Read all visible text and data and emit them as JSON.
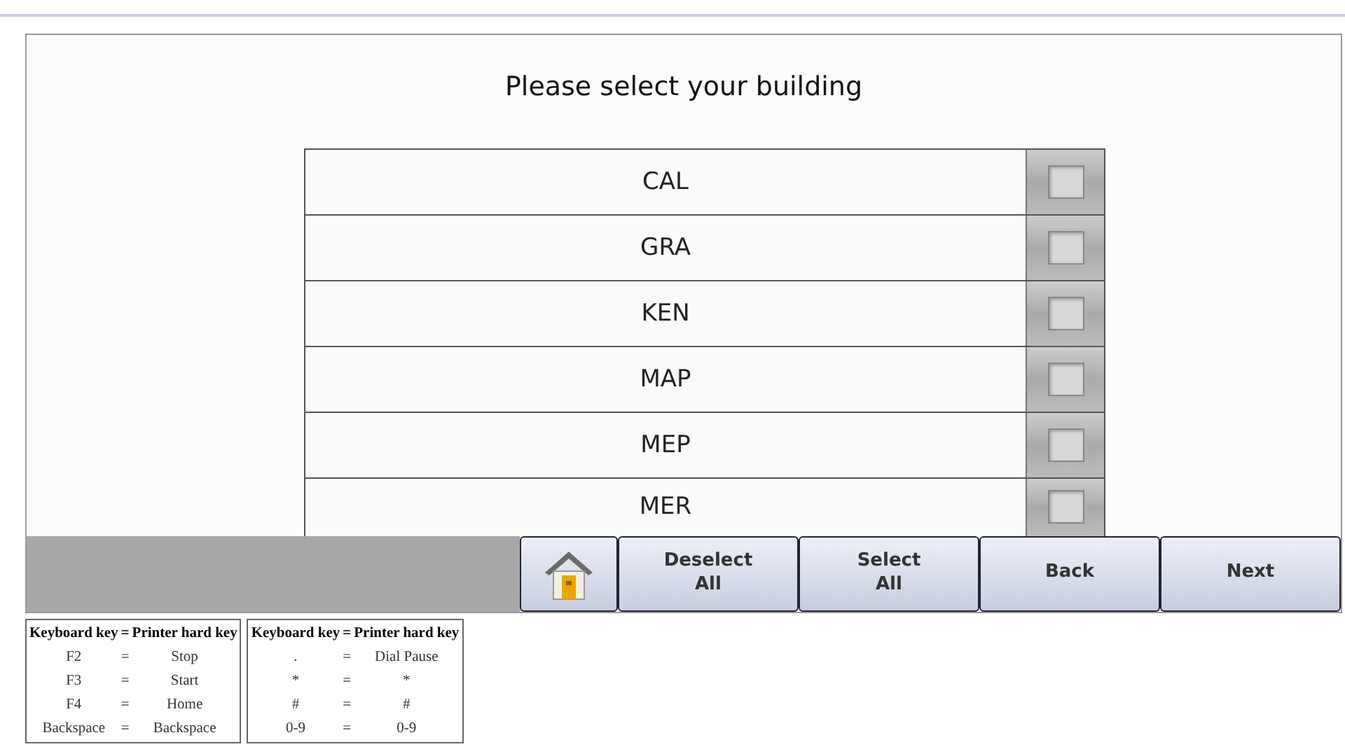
{
  "title": "Please select your building",
  "buildings": [
    {
      "name": "CAL",
      "checked": false
    },
    {
      "name": "GRA",
      "checked": false
    },
    {
      "name": "KEN",
      "checked": false
    },
    {
      "name": "MAP",
      "checked": false
    },
    {
      "name": "MEP",
      "checked": false
    },
    {
      "name": "MER",
      "checked": false
    }
  ],
  "toolbar": [
    {
      "kind": "home"
    },
    {
      "kind": "text",
      "label": "Deselect\nAll"
    },
    {
      "kind": "text",
      "label": "Select\nAll"
    },
    {
      "kind": "text",
      "label": "Back"
    },
    {
      "kind": "text",
      "label": "Next"
    }
  ],
  "key_tables": [
    {
      "header": [
        "Keyboard key",
        "=",
        "Printer hard key"
      ],
      "rows": [
        [
          "F2",
          "=",
          "Stop"
        ],
        [
          "F3",
          "=",
          "Start"
        ],
        [
          "F4",
          "=",
          "Home"
        ],
        [
          "Backspace",
          "=",
          "Backspace"
        ]
      ]
    },
    {
      "header": [
        "Keyboard key",
        "=",
        "Printer hard key"
      ],
      "rows": [
        [
          ".",
          "=",
          "Dial Pause"
        ],
        [
          "*",
          "=",
          "*"
        ],
        [
          "#",
          "=",
          "#"
        ],
        [
          "0-9",
          "=",
          "0-9"
        ]
      ]
    }
  ]
}
